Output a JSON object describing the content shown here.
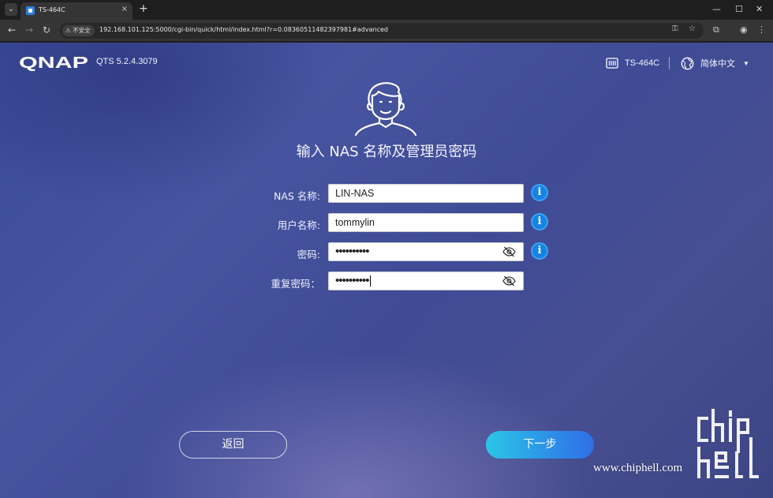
{
  "browser": {
    "tab_title": "TS-464C",
    "tab_close": "×",
    "new_tab": "+",
    "minimize": "—",
    "maximize": "☐",
    "close": "✕",
    "insecure_label": "不安全",
    "url": "192.168.101.125:5000/cgi-bin/quick/html/index.html?r=0.08360511482397981#advanced"
  },
  "header": {
    "logo": "QNAP",
    "version": "QTS 5.2.4.3079",
    "device_name": "TS-464C",
    "language": "简体中文"
  },
  "main": {
    "heading": "输入 NAS 名称及管理员密码",
    "fields": [
      {
        "label": "NAS 名称:",
        "value": "LIN-NAS"
      },
      {
        "label": "用户名称:",
        "value": "tommylin"
      },
      {
        "label": "密码:",
        "value": "••••••••••"
      },
      {
        "label": "重复密码：",
        "value": "••••••••••"
      }
    ],
    "info_glyph": "i"
  },
  "buttons": {
    "back": "返回",
    "next": "下一步"
  },
  "watermark": {
    "url": "www.chiphell.com",
    "logo_text": "chiphell"
  },
  "colors": {
    "accent": "#1583e2",
    "next_gradient_start": "#2bc6e6",
    "next_gradient_end": "#2f6fe6",
    "background": "#434f9a"
  }
}
